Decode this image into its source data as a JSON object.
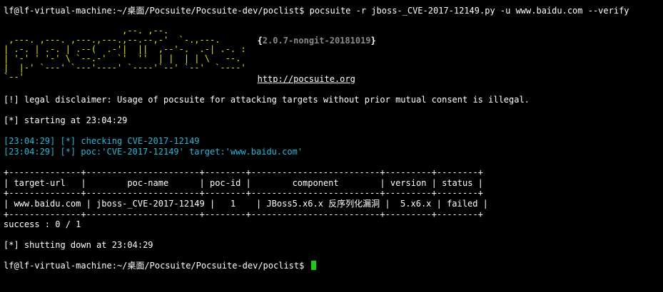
{
  "terminal": {
    "prompt": "lf@lf-virtual-machine:~/桌面/Pocsuite/Pocsuite-dev/poclist$",
    "command": "pocsuite -r jboss-_CVE-2017-12149.py -u www.baidu.com --verify",
    "logo_ascii": "                       ,--. ,--.\n ,---. ,---. ,---.,---.,--.--,-'  `-.,---.\n| .-. | .-. | .--(  .-'|  ||  ,--'-.  .-| .-. :\n| '-' ' '-' \\ `--.-'  `'  ''  | |  | | \\   --.\n|  |-' `---' `---'----' `----'`--' `--'  `----'\n`--'",
    "version_open": "{",
    "version": "2.0.7-nongit-20181019",
    "version_close": "}",
    "website": "http://pocsuite.org",
    "disclaimer": "[!] legal disclaimer: Usage of pocsuite for attacking targets without prior mutual consent is illegal.",
    "starting": "[*] starting at 23:04:29",
    "checking": "[23:04:29] [*] checking CVE-2017-12149",
    "poc_line": "[23:04:29] [*] poc:'CVE-2017-12149' target:'www.baidu.com'",
    "table_border": "+--------------+----------------------+--------+-------------------------+---------+--------+",
    "table_header": "| target-url   |        poc-name      | poc-id |        component        | version | status |",
    "table_row": "| www.baidu.com | jboss-_CVE-2017-12149 |   1    | JBoss5.x6.x 反序列化漏洞 |  5.x6.x | failed |",
    "success": "success : 0 / 1",
    "shutdown": "[*] shutting down at 23:04:29",
    "final_prompt": "lf@lf-virtual-machine:~/桌面/Pocsuite/Pocsuite-dev/poclist$"
  },
  "colors": {
    "background": "#000000",
    "text": "#ffffff",
    "logo": "#e5e510",
    "info": "#29b8db",
    "version": "#8a8a8a",
    "cursor": "#1ec81e"
  }
}
